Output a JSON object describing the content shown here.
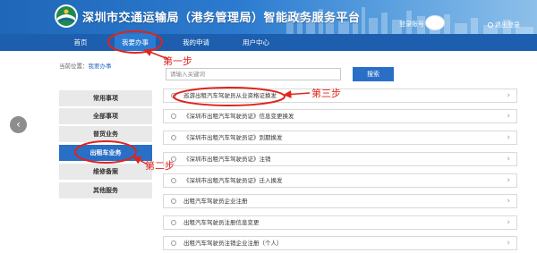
{
  "header": {
    "title": "深圳市交通运输局（港务管理局）智能政务服务平台",
    "login_label": "登录账号",
    "logout_label": "退出登录"
  },
  "nav": {
    "items": [
      {
        "label": "首页"
      },
      {
        "label": "我要办事",
        "active": true
      },
      {
        "label": "我的申请"
      },
      {
        "label": "用户中心"
      }
    ]
  },
  "breadcrumb": {
    "prefix": "当前位置：",
    "current": "我要办事"
  },
  "sidebar": {
    "items": [
      {
        "label": "常用事项"
      },
      {
        "label": "全部事项"
      },
      {
        "label": "普货业务"
      },
      {
        "label": "出租车业务",
        "active": true
      },
      {
        "label": "维修备案"
      },
      {
        "label": "其他服务"
      }
    ]
  },
  "search": {
    "placeholder": "请输入关键词",
    "button_label": "搜索"
  },
  "services": [
    {
      "label": "巡游出租汽车驾驶员从业资格证换发"
    },
    {
      "label": "《深圳市出租汽车驾驶员证》信息变更换发"
    },
    {
      "label": "《深圳市出租汽车驾驶员证》到期换发"
    },
    {
      "label": "《深圳市出租汽车驾驶员证》注销"
    },
    {
      "label": "《深圳市出租汽车驾驶员证》迁入换发"
    },
    {
      "label": "出租汽车驾驶员企业注册"
    },
    {
      "label": "出租汽车驾驶员注册信息变更"
    },
    {
      "label": "出租汽车驾驶员注销企业注册（个人）"
    }
  ],
  "annotations": {
    "step1": "第一步",
    "step2": "第二步",
    "step3": "第三步"
  },
  "colors": {
    "header_blue": "#1f67b8",
    "nav_blue": "#1d5fae",
    "accent_blue": "#2a6fc6",
    "annotation_red": "#e0241b"
  }
}
